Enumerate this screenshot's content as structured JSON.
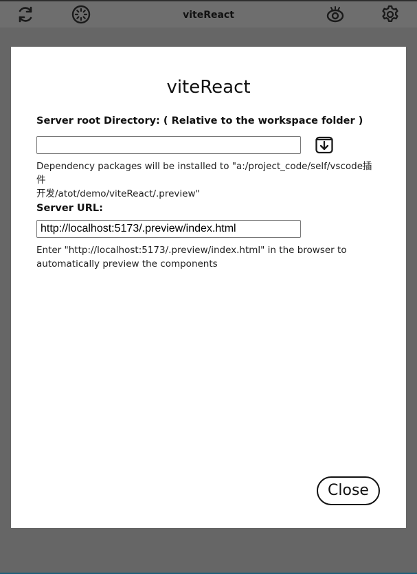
{
  "toolbar": {
    "title": "viteReact",
    "icons": [
      "refresh-icon",
      "loading-spinner-icon",
      "preview-eye-icon",
      "settings-gear-icon"
    ]
  },
  "dialog": {
    "title": "viteReact",
    "root_dir": {
      "label": "Server root Directory: ( Relative to the workspace folder )",
      "value": "",
      "hint_line1": "Dependency packages will be installed to \"a:/project_code/self/vscode插件",
      "hint_line2": "开发/atot/demo/viteReact/.preview\"",
      "install_icon": "download-icon"
    },
    "server_url": {
      "label": "Server URL:",
      "value": "http://localhost:5173/.preview/index.html",
      "hint_line1": "Enter \"http://localhost:5173/.preview/index.html\" in the browser to",
      "hint_line2": "automatically preview the components"
    },
    "close_label": "Close"
  },
  "colors": {
    "backdrop": "#666666",
    "toolbar": "#6e6e6e",
    "dialog": "#ffffff"
  }
}
